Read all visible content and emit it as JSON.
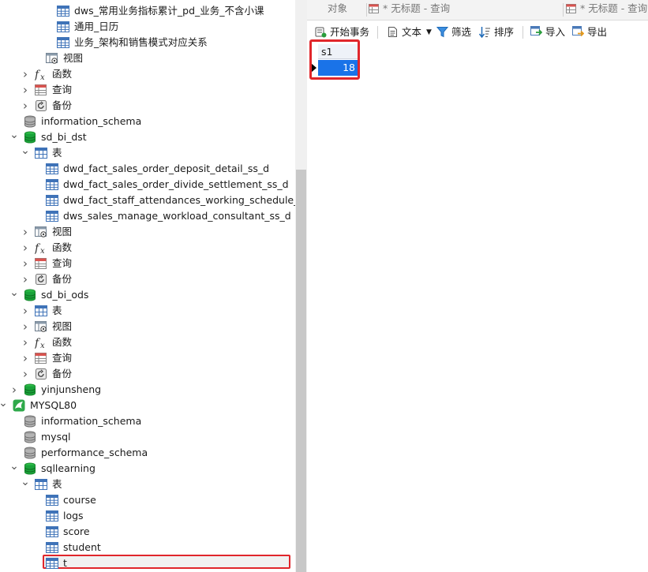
{
  "navigator": {
    "items": [
      {
        "level": 4,
        "icon": "table-icon",
        "label": "dws_常用业务指标累计_pd_业务_不含小课"
      },
      {
        "level": 4,
        "icon": "table-icon",
        "label": "通用_日历"
      },
      {
        "level": 4,
        "icon": "table-icon",
        "label": "业务_架构和销售模式对应关系"
      },
      {
        "level": 3,
        "icon": "view-icon",
        "label": "视图"
      },
      {
        "level": 2,
        "icon": "function-icon",
        "label": "函数",
        "chevron": "right"
      },
      {
        "level": 2,
        "icon": "query-icon",
        "label": "查询",
        "chevron": "right"
      },
      {
        "level": 2,
        "icon": "backup-icon",
        "label": "备份",
        "chevron": "right"
      },
      {
        "level": 1,
        "icon": "database-grey-icon",
        "label": "information_schema"
      },
      {
        "level": 1,
        "icon": "database-green-icon",
        "label": "sd_bi_dst",
        "chevron": "down"
      },
      {
        "level": 2,
        "icon": "tables-icon",
        "label": "表",
        "chevron": "down"
      },
      {
        "level": 3,
        "icon": "table-icon",
        "label": "dwd_fact_sales_order_deposit_detail_ss_d"
      },
      {
        "level": 3,
        "icon": "table-icon",
        "label": "dwd_fact_sales_order_divide_settlement_ss_d"
      },
      {
        "level": 3,
        "icon": "table-icon",
        "label": "dwd_fact_staff_attendances_working_schedule_ss_d"
      },
      {
        "level": 3,
        "icon": "table-icon",
        "label": "dws_sales_manage_workload_consultant_ss_d"
      },
      {
        "level": 2,
        "icon": "view-icon",
        "label": "视图",
        "chevron": "right"
      },
      {
        "level": 2,
        "icon": "function-icon",
        "label": "函数",
        "chevron": "right"
      },
      {
        "level": 2,
        "icon": "query-icon",
        "label": "查询",
        "chevron": "right"
      },
      {
        "level": 2,
        "icon": "backup-icon",
        "label": "备份",
        "chevron": "right"
      },
      {
        "level": 1,
        "icon": "database-green-icon",
        "label": "sd_bi_ods",
        "chevron": "down"
      },
      {
        "level": 2,
        "icon": "tables-icon",
        "label": "表",
        "chevron": "right"
      },
      {
        "level": 2,
        "icon": "view-icon",
        "label": "视图",
        "chevron": "right"
      },
      {
        "level": 2,
        "icon": "function-icon",
        "label": "函数",
        "chevron": "right"
      },
      {
        "level": 2,
        "icon": "query-icon",
        "label": "查询",
        "chevron": "right"
      },
      {
        "level": 2,
        "icon": "backup-icon",
        "label": "备份",
        "chevron": "right"
      },
      {
        "level": 1,
        "icon": "database-green-icon",
        "label": "yinjunsheng",
        "chevron": "right"
      },
      {
        "level": 0,
        "icon": "connection-icon",
        "label": "MYSQL80",
        "chevron": "down"
      },
      {
        "level": 1,
        "icon": "database-grey-icon",
        "label": "information_schema"
      },
      {
        "level": 1,
        "icon": "database-grey-icon",
        "label": "mysql"
      },
      {
        "level": 1,
        "icon": "database-grey-icon",
        "label": "performance_schema"
      },
      {
        "level": 1,
        "icon": "database-green-icon",
        "label": "sqllearning",
        "chevron": "down"
      },
      {
        "level": 2,
        "icon": "tables-icon",
        "label": "表",
        "chevron": "down"
      },
      {
        "level": 3,
        "icon": "table-icon",
        "label": "course"
      },
      {
        "level": 3,
        "icon": "table-icon",
        "label": "logs"
      },
      {
        "level": 3,
        "icon": "table-icon",
        "label": "score"
      },
      {
        "level": 3,
        "icon": "table-icon",
        "label": "student"
      },
      {
        "level": 3,
        "icon": "table-icon",
        "label": "t",
        "selected": true
      }
    ]
  },
  "tabs": [
    {
      "label": "对象"
    },
    {
      "label": "* 无标题 - 查询"
    },
    {
      "label": "* 无标题 - 查询"
    }
  ],
  "toolbar": {
    "begin_transaction": "开始事务",
    "text": "文本",
    "filter": "筛选",
    "sort": "排序",
    "import": "导入",
    "export": "导出"
  },
  "result": {
    "column": "s1",
    "value": "18"
  },
  "colors": {
    "highlight_red": "#e0262b",
    "selection_blue": "#1a73e8",
    "db_green": "#1aa33a"
  }
}
